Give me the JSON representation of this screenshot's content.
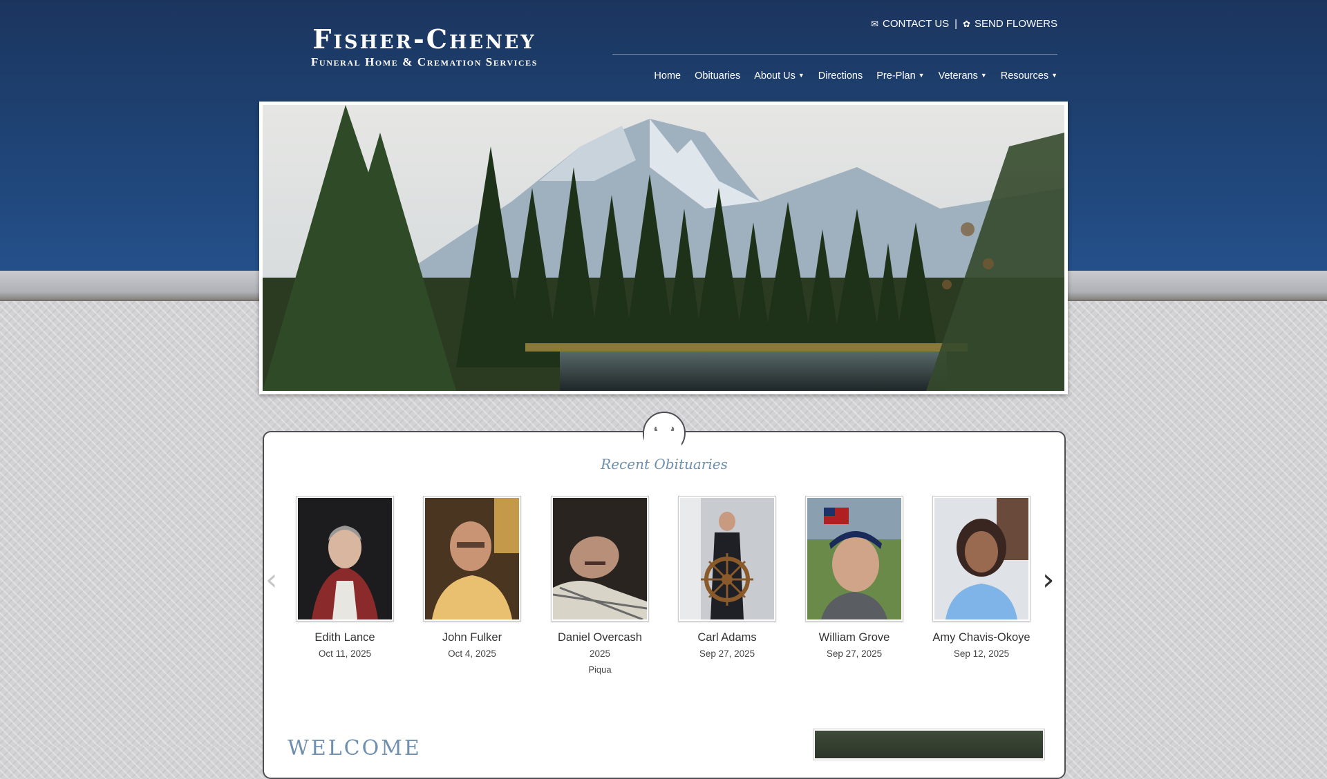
{
  "logo": {
    "title": "Fisher-Cheney",
    "subtitle": "Funeral Home & Cremation Services"
  },
  "utility": {
    "contact_label": "CONTACT US",
    "separator": "|",
    "flowers_label": "SEND FLOWERS",
    "contact_icon": "envelope-icon",
    "flowers_icon": "flower-icon"
  },
  "nav": {
    "items": [
      {
        "label": "Home",
        "dropdown": false
      },
      {
        "label": "Obituaries",
        "dropdown": false
      },
      {
        "label": "About Us",
        "dropdown": true
      },
      {
        "label": "Directions",
        "dropdown": false
      },
      {
        "label": "Pre-Plan",
        "dropdown": true
      },
      {
        "label": "Veterans",
        "dropdown": true
      },
      {
        "label": "Resources",
        "dropdown": true
      }
    ],
    "caret": "▼"
  },
  "section": {
    "title": "Recent Obituaries",
    "prev_icon": "chevron-left-icon",
    "next_icon": "chevron-right-icon",
    "prev_glyph": "‹",
    "next_glyph": "›"
  },
  "obituaries": [
    {
      "name": "Edith Lance",
      "date": "Oct 11, 2025",
      "location": ""
    },
    {
      "name": "John Fulker",
      "date": "Oct 4, 2025",
      "location": ""
    },
    {
      "name": "Daniel Overcash",
      "date": "2025",
      "location": "Piqua"
    },
    {
      "name": "Carl Adams",
      "date": "Sep 27, 2025",
      "location": ""
    },
    {
      "name": "William Grove",
      "date": "Sep 27, 2025",
      "location": ""
    },
    {
      "name": "Amy Chavis-Okoye",
      "date": "Sep 12, 2025",
      "location": ""
    }
  ],
  "welcome": {
    "heading": "WELCOME"
  },
  "colors": {
    "header_blue": "#1f4476",
    "accent_title": "#6f8fae",
    "panel_border": "#4d4f55"
  }
}
